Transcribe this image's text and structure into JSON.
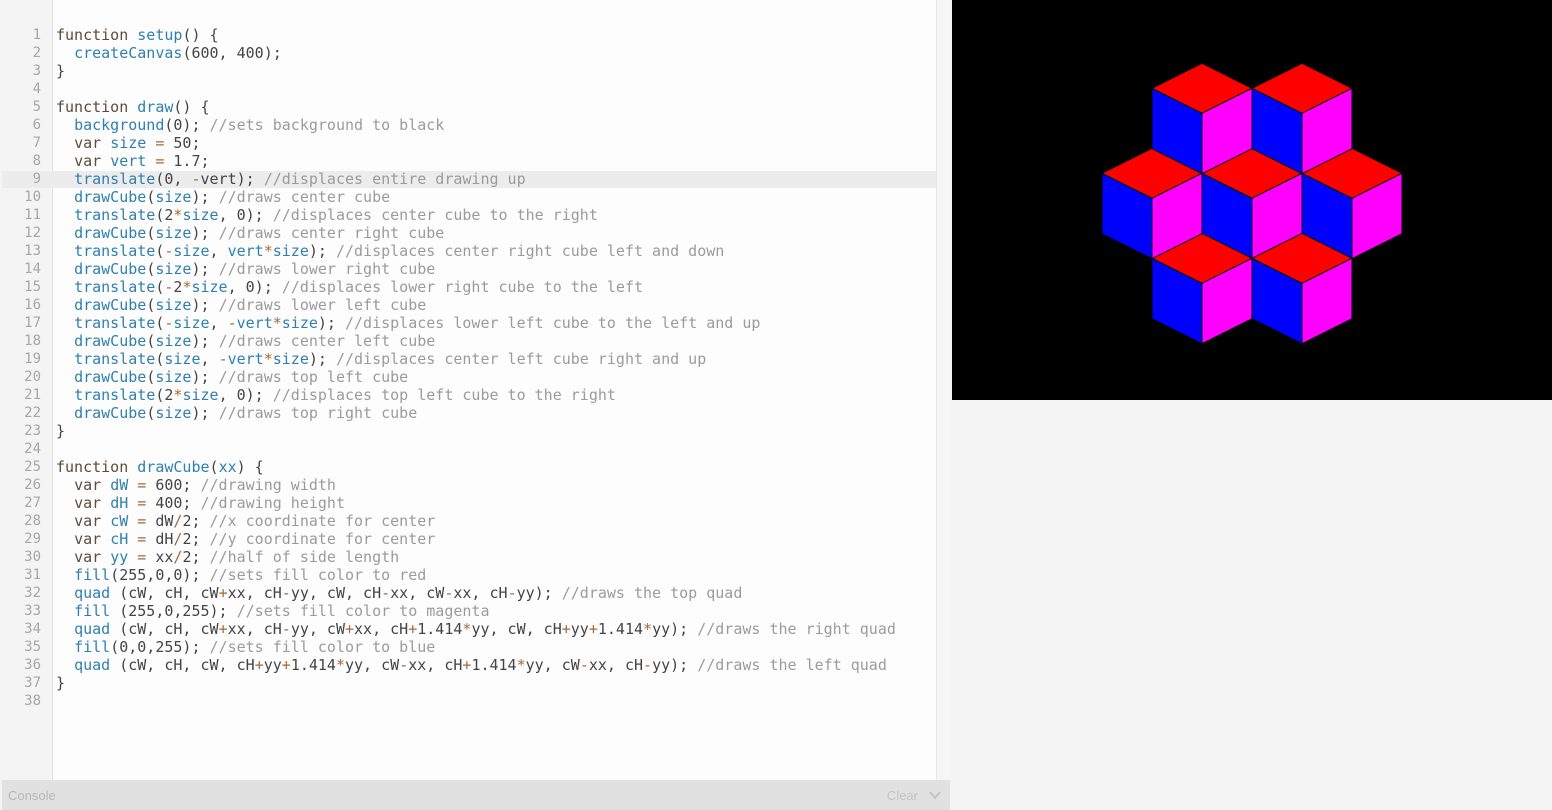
{
  "editor": {
    "highlighted_line": 9,
    "lines": [
      [
        [
          "kw",
          "function "
        ],
        [
          "fn",
          "setup"
        ],
        [
          "",
          "() {"
        ]
      ],
      [
        [
          "",
          "  "
        ],
        [
          "fn",
          "createCanvas"
        ],
        [
          "",
          "(600, 400);"
        ]
      ],
      [
        [
          "",
          "}"
        ]
      ],
      [],
      [
        [
          "kw",
          "function "
        ],
        [
          "fn",
          "draw"
        ],
        [
          "",
          "() {"
        ]
      ],
      [
        [
          "",
          "  "
        ],
        [
          "fn",
          "background"
        ],
        [
          "",
          "(0); "
        ],
        [
          "cm",
          "//sets background to black"
        ]
      ],
      [
        [
          "",
          "  "
        ],
        [
          "kw",
          "var "
        ],
        [
          "fn",
          "size"
        ],
        [
          "op",
          " = "
        ],
        [
          "",
          "50;"
        ]
      ],
      [
        [
          "",
          "  "
        ],
        [
          "kw",
          "var "
        ],
        [
          "fn",
          "vert"
        ],
        [
          "op",
          " = "
        ],
        [
          "",
          "1.7;"
        ]
      ],
      [
        [
          "",
          "  "
        ],
        [
          "fn",
          "translate"
        ],
        [
          "",
          "(0, "
        ],
        [
          "op",
          "-"
        ],
        [
          "",
          "vert); "
        ],
        [
          "cm",
          "//displaces entire drawing up"
        ]
      ],
      [
        [
          "",
          "  "
        ],
        [
          "fn",
          "drawCube"
        ],
        [
          "",
          "("
        ],
        [
          "fn",
          "size"
        ],
        [
          "",
          "); "
        ],
        [
          "cm",
          "//draws center cube"
        ]
      ],
      [
        [
          "",
          "  "
        ],
        [
          "fn",
          "translate"
        ],
        [
          "",
          "(2"
        ],
        [
          "op",
          "*"
        ],
        [
          "fn",
          "size"
        ],
        [
          "",
          ", 0); "
        ],
        [
          "cm",
          "//displaces center cube to the right"
        ]
      ],
      [
        [
          "",
          "  "
        ],
        [
          "fn",
          "drawCube"
        ],
        [
          "",
          "("
        ],
        [
          "fn",
          "size"
        ],
        [
          "",
          "); "
        ],
        [
          "cm",
          "//draws center right cube"
        ]
      ],
      [
        [
          "",
          "  "
        ],
        [
          "fn",
          "translate"
        ],
        [
          "",
          "("
        ],
        [
          "op",
          "-"
        ],
        [
          "fn",
          "size"
        ],
        [
          "",
          ", "
        ],
        [
          "fn",
          "vert"
        ],
        [
          "op",
          "*"
        ],
        [
          "fn",
          "size"
        ],
        [
          "",
          "); "
        ],
        [
          "cm",
          "//displaces center right cube left and down"
        ]
      ],
      [
        [
          "",
          "  "
        ],
        [
          "fn",
          "drawCube"
        ],
        [
          "",
          "("
        ],
        [
          "fn",
          "size"
        ],
        [
          "",
          "); "
        ],
        [
          "cm",
          "//draws lower right cube"
        ]
      ],
      [
        [
          "",
          "  "
        ],
        [
          "fn",
          "translate"
        ],
        [
          "",
          "("
        ],
        [
          "op",
          "-"
        ],
        [
          "",
          "2"
        ],
        [
          "op",
          "*"
        ],
        [
          "fn",
          "size"
        ],
        [
          "",
          ", 0); "
        ],
        [
          "cm",
          "//displaces lower right cube to the left"
        ]
      ],
      [
        [
          "",
          "  "
        ],
        [
          "fn",
          "drawCube"
        ],
        [
          "",
          "("
        ],
        [
          "fn",
          "size"
        ],
        [
          "",
          "); "
        ],
        [
          "cm",
          "//draws lower left cube"
        ]
      ],
      [
        [
          "",
          "  "
        ],
        [
          "fn",
          "translate"
        ],
        [
          "",
          "("
        ],
        [
          "op",
          "-"
        ],
        [
          "fn",
          "size"
        ],
        [
          "",
          ", "
        ],
        [
          "op",
          "-"
        ],
        [
          "fn",
          "vert"
        ],
        [
          "op",
          "*"
        ],
        [
          "fn",
          "size"
        ],
        [
          "",
          "); "
        ],
        [
          "cm",
          "//displaces lower left cube to the left and up"
        ]
      ],
      [
        [
          "",
          "  "
        ],
        [
          "fn",
          "drawCube"
        ],
        [
          "",
          "("
        ],
        [
          "fn",
          "size"
        ],
        [
          "",
          "); "
        ],
        [
          "cm",
          "//draws center left cube"
        ]
      ],
      [
        [
          "",
          "  "
        ],
        [
          "fn",
          "translate"
        ],
        [
          "",
          "("
        ],
        [
          "fn",
          "size"
        ],
        [
          "",
          ", "
        ],
        [
          "op",
          "-"
        ],
        [
          "fn",
          "vert"
        ],
        [
          "op",
          "*"
        ],
        [
          "fn",
          "size"
        ],
        [
          "",
          "); "
        ],
        [
          "cm",
          "//displaces center left cube right and up"
        ]
      ],
      [
        [
          "",
          "  "
        ],
        [
          "fn",
          "drawCube"
        ],
        [
          "",
          "("
        ],
        [
          "fn",
          "size"
        ],
        [
          "",
          "); "
        ],
        [
          "cm",
          "//draws top left cube"
        ]
      ],
      [
        [
          "",
          "  "
        ],
        [
          "fn",
          "translate"
        ],
        [
          "",
          "(2"
        ],
        [
          "op",
          "*"
        ],
        [
          "fn",
          "size"
        ],
        [
          "",
          ", 0); "
        ],
        [
          "cm",
          "//displaces top left cube to the right"
        ]
      ],
      [
        [
          "",
          "  "
        ],
        [
          "fn",
          "drawCube"
        ],
        [
          "",
          "("
        ],
        [
          "fn",
          "size"
        ],
        [
          "",
          "); "
        ],
        [
          "cm",
          "//draws top right cube"
        ]
      ],
      [
        [
          "",
          "}"
        ]
      ],
      [],
      [
        [
          "kw",
          "function "
        ],
        [
          "fn",
          "drawCube"
        ],
        [
          "",
          "("
        ],
        [
          "fn",
          "xx"
        ],
        [
          "",
          ") {"
        ]
      ],
      [
        [
          "",
          "  "
        ],
        [
          "kw",
          "var "
        ],
        [
          "fn",
          "dW"
        ],
        [
          "op",
          " = "
        ],
        [
          "",
          "600; "
        ],
        [
          "cm",
          "//drawing width"
        ]
      ],
      [
        [
          "",
          "  "
        ],
        [
          "kw",
          "var "
        ],
        [
          "fn",
          "dH"
        ],
        [
          "op",
          " = "
        ],
        [
          "",
          "400; "
        ],
        [
          "cm",
          "//drawing height"
        ]
      ],
      [
        [
          "",
          "  "
        ],
        [
          "kw",
          "var "
        ],
        [
          "fn",
          "cW"
        ],
        [
          "op",
          " = "
        ],
        [
          "",
          "dW"
        ],
        [
          "op",
          "/"
        ],
        [
          "",
          "2; "
        ],
        [
          "cm",
          "//x coordinate for center"
        ]
      ],
      [
        [
          "",
          "  "
        ],
        [
          "kw",
          "var "
        ],
        [
          "fn",
          "cH"
        ],
        [
          "op",
          " = "
        ],
        [
          "",
          "dH"
        ],
        [
          "op",
          "/"
        ],
        [
          "",
          "2; "
        ],
        [
          "cm",
          "//y coordinate for center"
        ]
      ],
      [
        [
          "",
          "  "
        ],
        [
          "kw",
          "var "
        ],
        [
          "fn",
          "yy"
        ],
        [
          "op",
          " = "
        ],
        [
          "",
          "xx"
        ],
        [
          "op",
          "/"
        ],
        [
          "",
          "2; "
        ],
        [
          "cm",
          "//half of side length"
        ]
      ],
      [
        [
          "",
          "  "
        ],
        [
          "fn",
          "fill"
        ],
        [
          "",
          "(255,0,0); "
        ],
        [
          "cm",
          "//sets fill color to red"
        ]
      ],
      [
        [
          "",
          "  "
        ],
        [
          "fn",
          "quad"
        ],
        [
          "",
          " (cW, cH, cW"
        ],
        [
          "op",
          "+"
        ],
        [
          "",
          "xx, cH"
        ],
        [
          "op",
          "-"
        ],
        [
          "",
          "yy, cW, cH"
        ],
        [
          "op",
          "-"
        ],
        [
          "",
          "xx, cW"
        ],
        [
          "op",
          "-"
        ],
        [
          "",
          "xx, cH"
        ],
        [
          "op",
          "-"
        ],
        [
          "",
          "yy); "
        ],
        [
          "cm",
          "//draws the top quad"
        ]
      ],
      [
        [
          "",
          "  "
        ],
        [
          "fn",
          "fill"
        ],
        [
          "",
          " (255,0,255); "
        ],
        [
          "cm",
          "//sets fill color to magenta"
        ]
      ],
      [
        [
          "",
          "  "
        ],
        [
          "fn",
          "quad"
        ],
        [
          "",
          " (cW, cH, cW"
        ],
        [
          "op",
          "+"
        ],
        [
          "",
          "xx, cH"
        ],
        [
          "op",
          "-"
        ],
        [
          "",
          "yy, cW"
        ],
        [
          "op",
          "+"
        ],
        [
          "",
          "xx, cH"
        ],
        [
          "op",
          "+"
        ],
        [
          "",
          "1.414"
        ],
        [
          "op",
          "*"
        ],
        [
          "",
          "yy, cW, cH"
        ],
        [
          "op",
          "+"
        ],
        [
          "",
          "yy"
        ],
        [
          "op",
          "+"
        ],
        [
          "",
          "1.414"
        ],
        [
          "op",
          "*"
        ],
        [
          "",
          "yy); "
        ],
        [
          "cm",
          "//draws the right quad"
        ]
      ],
      [
        [
          "",
          "  "
        ],
        [
          "fn",
          "fill"
        ],
        [
          "",
          "(0,0,255); "
        ],
        [
          "cm",
          "//sets fill color to blue"
        ]
      ],
      [
        [
          "",
          "  "
        ],
        [
          "fn",
          "quad"
        ],
        [
          "",
          " (cW, cH, cW, cH"
        ],
        [
          "op",
          "+"
        ],
        [
          "",
          "yy"
        ],
        [
          "op",
          "+"
        ],
        [
          "",
          "1.414"
        ],
        [
          "op",
          "*"
        ],
        [
          "",
          "yy, cW"
        ],
        [
          "op",
          "-"
        ],
        [
          "",
          "xx, cH"
        ],
        [
          "op",
          "+"
        ],
        [
          "",
          "1.414"
        ],
        [
          "op",
          "*"
        ],
        [
          "",
          "yy, cW"
        ],
        [
          "op",
          "-"
        ],
        [
          "",
          "xx, cH"
        ],
        [
          "op",
          "-"
        ],
        [
          "",
          "yy); "
        ],
        [
          "cm",
          "//draws the left quad"
        ]
      ],
      [
        [
          "",
          "}"
        ]
      ],
      []
    ]
  },
  "console": {
    "label": "Console",
    "clear_label": "Clear"
  },
  "preview": {
    "background": "#000000",
    "colors": {
      "top": "#ff0000",
      "right": "#ff00ff",
      "left": "#0000ff"
    },
    "sketch": {
      "size": 50,
      "vert": 1.7,
      "canvas_width": 600,
      "canvas_height": 400
    }
  }
}
